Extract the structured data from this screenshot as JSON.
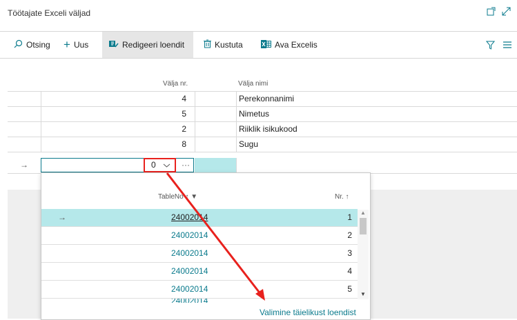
{
  "page": {
    "title": "Töötajate Exceli väljad"
  },
  "toolbar": {
    "search": "Otsing",
    "new": "Uus",
    "edit_list": "Redigeeri loendit",
    "delete": "Kustuta",
    "open_excel": "Ava Excelis"
  },
  "grid": {
    "headers": {
      "field_no": "Välja nr.",
      "field_name": "Välja nimi"
    },
    "rows": [
      {
        "field_no": "4",
        "field_name": "Perekonnanimi"
      },
      {
        "field_no": "5",
        "field_name": "Nimetus"
      },
      {
        "field_no": "2",
        "field_name": "Riiklik isikukood"
      },
      {
        "field_no": "8",
        "field_name": "Sugu"
      }
    ],
    "new_row": {
      "arrow": "→",
      "value": "0",
      "more": "···"
    }
  },
  "lookup": {
    "headers": {
      "table_no": "TableNo ↑",
      "nr": "Nr. ↑"
    },
    "rows": [
      {
        "table_no": "24002014",
        "nr": "1"
      },
      {
        "table_no": "24002014",
        "nr": "2"
      },
      {
        "table_no": "24002014",
        "nr": "3"
      },
      {
        "table_no": "24002014",
        "nr": "4"
      },
      {
        "table_no": "24002014",
        "nr": "5"
      }
    ],
    "partial_row": "24002014",
    "selected_arrow": "→",
    "footer_link": "Valimine täielikust loendist"
  },
  "colors": {
    "accent": "#0a7a8c",
    "highlight": "#e8211d",
    "selection": "#b5e8ea"
  }
}
